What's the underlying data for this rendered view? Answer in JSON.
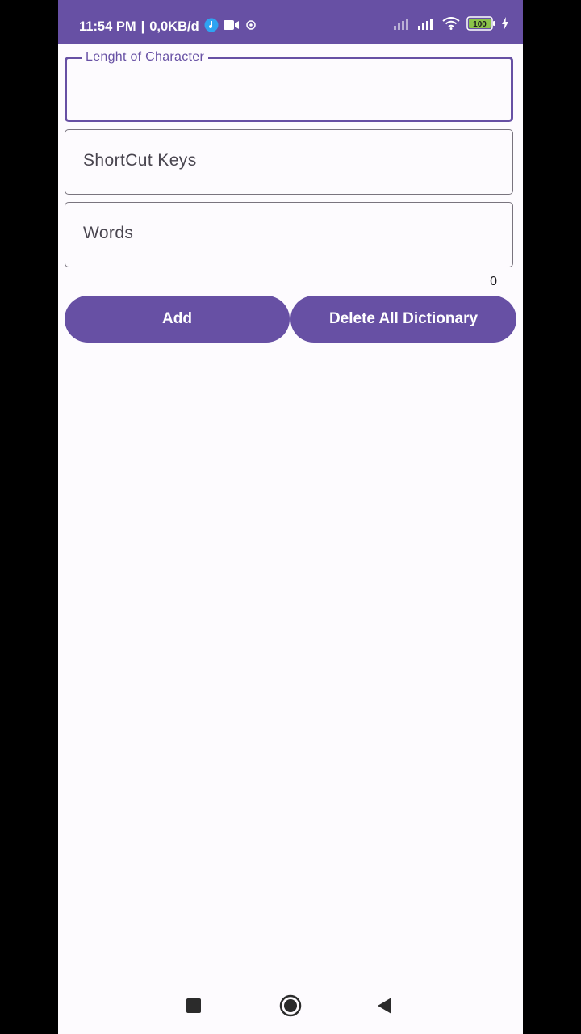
{
  "status": {
    "time": "11:54 PM",
    "separator": "|",
    "network_speed": "0,0KB/d",
    "battery": "100"
  },
  "form": {
    "length_field": {
      "label": "Lenght of Character",
      "value": ""
    },
    "shortcut_field": {
      "placeholder": "ShortCut Keys"
    },
    "words_field": {
      "placeholder": "Words"
    },
    "counter": "0"
  },
  "actions": {
    "add_label": "Add",
    "delete_all_label": "Delete All Dictionary"
  },
  "colors": {
    "primary": "#6750a4",
    "background": "#fdfbfe",
    "outline": "#79747e"
  },
  "icons": {
    "status": [
      "music-note-icon",
      "video-camera-icon",
      "vpn-icon",
      "signal-icon",
      "signal-icon",
      "wifi-icon",
      "battery-icon",
      "charging-icon"
    ],
    "nav": [
      "recent-apps-icon",
      "home-icon",
      "back-icon"
    ]
  }
}
